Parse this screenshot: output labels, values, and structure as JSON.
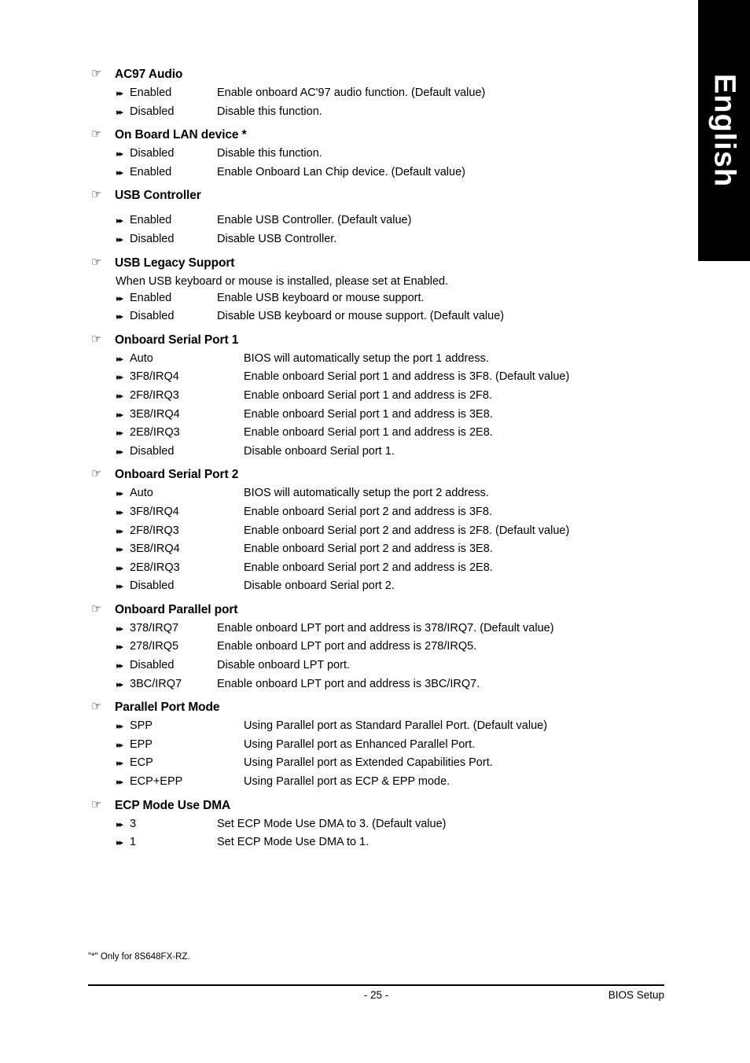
{
  "side_tab": {
    "label": "English"
  },
  "icons": {
    "heading_marker": "pointing-hand-icon",
    "option_marker": "double-right-arrow-icon",
    "heading_glyph": "☞",
    "option_glyph": "▸▸"
  },
  "sections": [
    {
      "title": "AC97 Audio",
      "desc_col": 275,
      "note": null,
      "extra_gap": false,
      "options": [
        {
          "label": "Enabled",
          "desc": "Enable onboard AC'97 audio function. (Default value)"
        },
        {
          "label": "Disabled",
          "desc": "Disable this function."
        }
      ]
    },
    {
      "title": "On Board  LAN device *",
      "desc_col": 275,
      "note": null,
      "extra_gap": false,
      "options": [
        {
          "label": "Disabled",
          "desc": "Disable this function."
        },
        {
          "label": "Enabled",
          "desc": "Enable Onboard Lan Chip device. (Default value)"
        }
      ]
    },
    {
      "title": "USB Controller",
      "desc_col": 275,
      "note": null,
      "extra_gap": true,
      "options": [
        {
          "label": "Enabled",
          "desc": "Enable USB Controller. (Default value)"
        },
        {
          "label": "Disabled",
          "desc": "Disable USB Controller."
        }
      ]
    },
    {
      "title": "USB Legacy Support",
      "desc_col": 275,
      "note": "When USB keyboard or mouse is installed, please set at Enabled.",
      "extra_gap": true,
      "options": [
        {
          "label": "Enabled",
          "desc": "Enable USB keyboard or mouse support."
        },
        {
          "label": "Disabled",
          "desc": "Disable USB keyboard or mouse support. (Default value)"
        }
      ]
    },
    {
      "title": "Onboard Serial Port 1",
      "desc_col": 310,
      "note": null,
      "extra_gap": false,
      "options": [
        {
          "label": "Auto",
          "desc": "BIOS will automatically setup the port 1 address."
        },
        {
          "label": "3F8/IRQ4",
          "desc": "Enable onboard Serial port 1 and address is 3F8. (Default value)"
        },
        {
          "label": "2F8/IRQ3",
          "desc": "Enable onboard Serial port 1 and address is 2F8."
        },
        {
          "label": "3E8/IRQ4",
          "desc": "Enable onboard Serial port 1 and address is 3E8."
        },
        {
          "label": "2E8/IRQ3",
          "desc": "Enable onboard Serial port 1 and address is 2E8."
        },
        {
          "label": "Disabled",
          "desc": "Disable onboard Serial port 1."
        }
      ]
    },
    {
      "title": "Onboard Serial Port 2",
      "desc_col": 310,
      "note": null,
      "extra_gap": false,
      "options": [
        {
          "label": "Auto",
          "desc": "BIOS will automatically setup the port 2 address."
        },
        {
          "label": "3F8/IRQ4",
          "desc": "Enable onboard Serial port 2 and address is 3F8."
        },
        {
          "label": "2F8/IRQ3",
          "desc": "Enable onboard Serial port 2 and address is 2F8. (Default value)"
        },
        {
          "label": "3E8/IRQ4",
          "desc": "Enable onboard Serial port 2 and address is 3E8."
        },
        {
          "label": "2E8/IRQ3",
          "desc": "Enable onboard Serial port 2 and address is 2E8."
        },
        {
          "label": "Disabled",
          "desc": "Disable onboard Serial port 2."
        }
      ]
    },
    {
      "title": "Onboard Parallel port",
      "desc_col": 275,
      "note": null,
      "extra_gap": false,
      "options": [
        {
          "label": "378/IRQ7",
          "desc": "Enable onboard LPT port and address is 378/IRQ7. (Default value)"
        },
        {
          "label": "278/IRQ5",
          "desc": "Enable onboard LPT port and address is 278/IRQ5."
        },
        {
          "label": "Disabled",
          "desc": "Disable onboard LPT port."
        },
        {
          "label": "3BC/IRQ7",
          "desc": "Enable onboard LPT port and address is 3BC/IRQ7."
        }
      ]
    },
    {
      "title": "Parallel Port Mode",
      "desc_col": 310,
      "note": null,
      "extra_gap": false,
      "options": [
        {
          "label": "SPP",
          "desc": "Using Parallel port as Standard Parallel Port. (Default value)"
        },
        {
          "label": "EPP",
          "desc": "Using Parallel port as Enhanced Parallel Port."
        },
        {
          "label": "ECP",
          "desc": "Using Parallel port as Extended Capabilities Port."
        },
        {
          "label": "ECP+EPP",
          "desc": "Using Parallel port as ECP & EPP mode."
        }
      ]
    },
    {
      "title": "ECP Mode Use DMA",
      "desc_col": 275,
      "note": null,
      "extra_gap": false,
      "options": [
        {
          "label": "3",
          "desc": "Set ECP Mode Use DMA to 3. (Default value)"
        },
        {
          "label": "1",
          "desc": "Set ECP Mode Use DMA to 1."
        }
      ]
    }
  ],
  "footnote": "\"*\" Only for  8S648FX-RZ.",
  "footer": {
    "page_number": "- 25 -",
    "right_label": "BIOS Setup"
  }
}
